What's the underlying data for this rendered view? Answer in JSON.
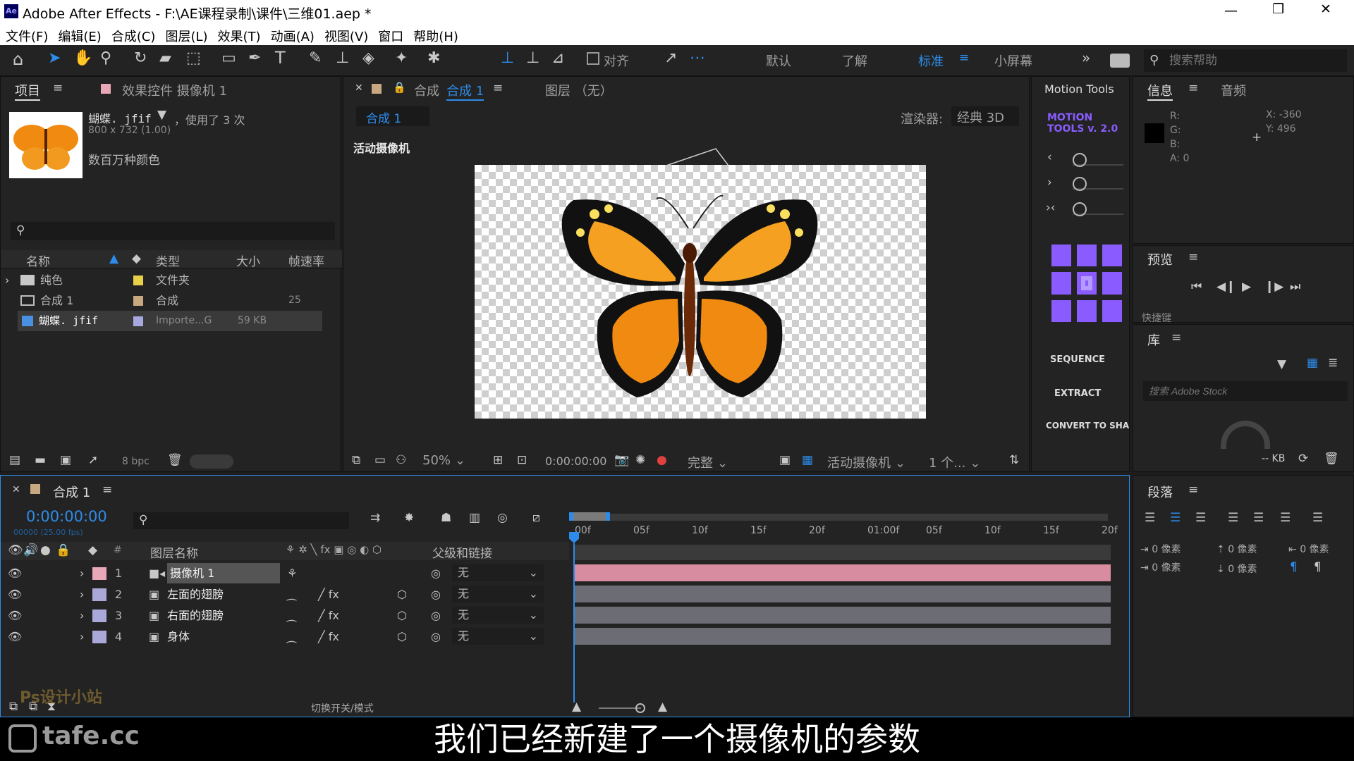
{
  "window": {
    "title": "Adobe After Effects - F:\\AE课程录制\\课件\\三维01.aep *",
    "app_badge": "Ae"
  },
  "menu": [
    "文件(F)",
    "编辑(E)",
    "合成(C)",
    "图层(L)",
    "效果(T)",
    "动画(A)",
    "视图(V)",
    "窗口",
    "帮助(H)"
  ],
  "toolbar": {
    "align": "对齐",
    "workspaces": [
      "默认",
      "了解",
      "标准",
      "小屏幕"
    ],
    "active_workspace": "标准",
    "search_placeholder": "搜索帮助"
  },
  "project": {
    "tab": "项目",
    "effects_tab": "效果控件 摄像机 1",
    "file_name": "蝴蝶. jfif",
    "used": "，使用了 3 次",
    "dims": "800 x 732 (1.00)",
    "colors": "数百万种颜色",
    "columns": [
      "名称",
      "类型",
      "大小",
      "帧速率"
    ],
    "items": [
      {
        "name": "纯色",
        "type": "文件夹",
        "size": "",
        "fps": ""
      },
      {
        "name": "合成 1",
        "type": "合成",
        "size": "",
        "fps": "25"
      },
      {
        "name": "蝴蝶. jfif",
        "type": "Importe...G",
        "size": "59 KB",
        "fps": ""
      }
    ],
    "bpc": "8 bpc"
  },
  "comp": {
    "tab": "合成",
    "tab_name": "合成 1",
    "layer_tab": "图层 （无）",
    "breadcrumb": "合成 1",
    "renderer_label": "渲染器:",
    "renderer": "经典 3D",
    "active_camera": "活动摄像机",
    "zoom": "50%",
    "timecode": "0:00:00:00",
    "quality": "完整",
    "view": "活动摄像机",
    "views": "1 个..."
  },
  "motion_tools": {
    "title": "Motion Tools",
    "logo": "MOTION TOOLS v. 2.0",
    "sequence": "SEQUENCE",
    "extract": "EXTRACT",
    "convert": "CONVERT TO SHAP"
  },
  "info": {
    "tab": "信息",
    "audio_tab": "音频",
    "r": "R:",
    "g": "G:",
    "b": "B:",
    "a": "A: 0",
    "x": "X: -360",
    "y": "Y: 496"
  },
  "preview": {
    "title": "预览",
    "shortcut": "快捷键"
  },
  "library": {
    "title": "库",
    "search_placeholder": "搜索 Adobe Stock",
    "kb": "-- KB"
  },
  "paragraph": {
    "title": "段落",
    "px": "0 像素"
  },
  "timeline": {
    "tab": "合成 1",
    "timecode": "0:00:00:00",
    "fps_sub": "00000 (25.00 fps)",
    "col_layer": "图层名称",
    "col_parent": "父级和链接",
    "toggle": "切换开关/模式",
    "ruler": [
      "00f",
      "05f",
      "10f",
      "15f",
      "20f",
      "01:00f",
      "05f",
      "10f",
      "15f",
      "20f"
    ],
    "layers": [
      {
        "num": "1",
        "name": "摄像机 1",
        "parent": "无",
        "color": "#e8a8b8"
      },
      {
        "num": "2",
        "name": "左面的翅膀",
        "parent": "无",
        "color": "#aaa8d8"
      },
      {
        "num": "3",
        "name": "右面的翅膀",
        "parent": "无",
        "color": "#aaa8d8"
      },
      {
        "num": "4",
        "name": "身体",
        "parent": "无",
        "color": "#aaa8d8"
      }
    ]
  },
  "watermark": {
    "site": "tafe.cc",
    "studio": "Ps设计小站"
  },
  "subtitle": "我们已经新建了一个摄像机的参数"
}
